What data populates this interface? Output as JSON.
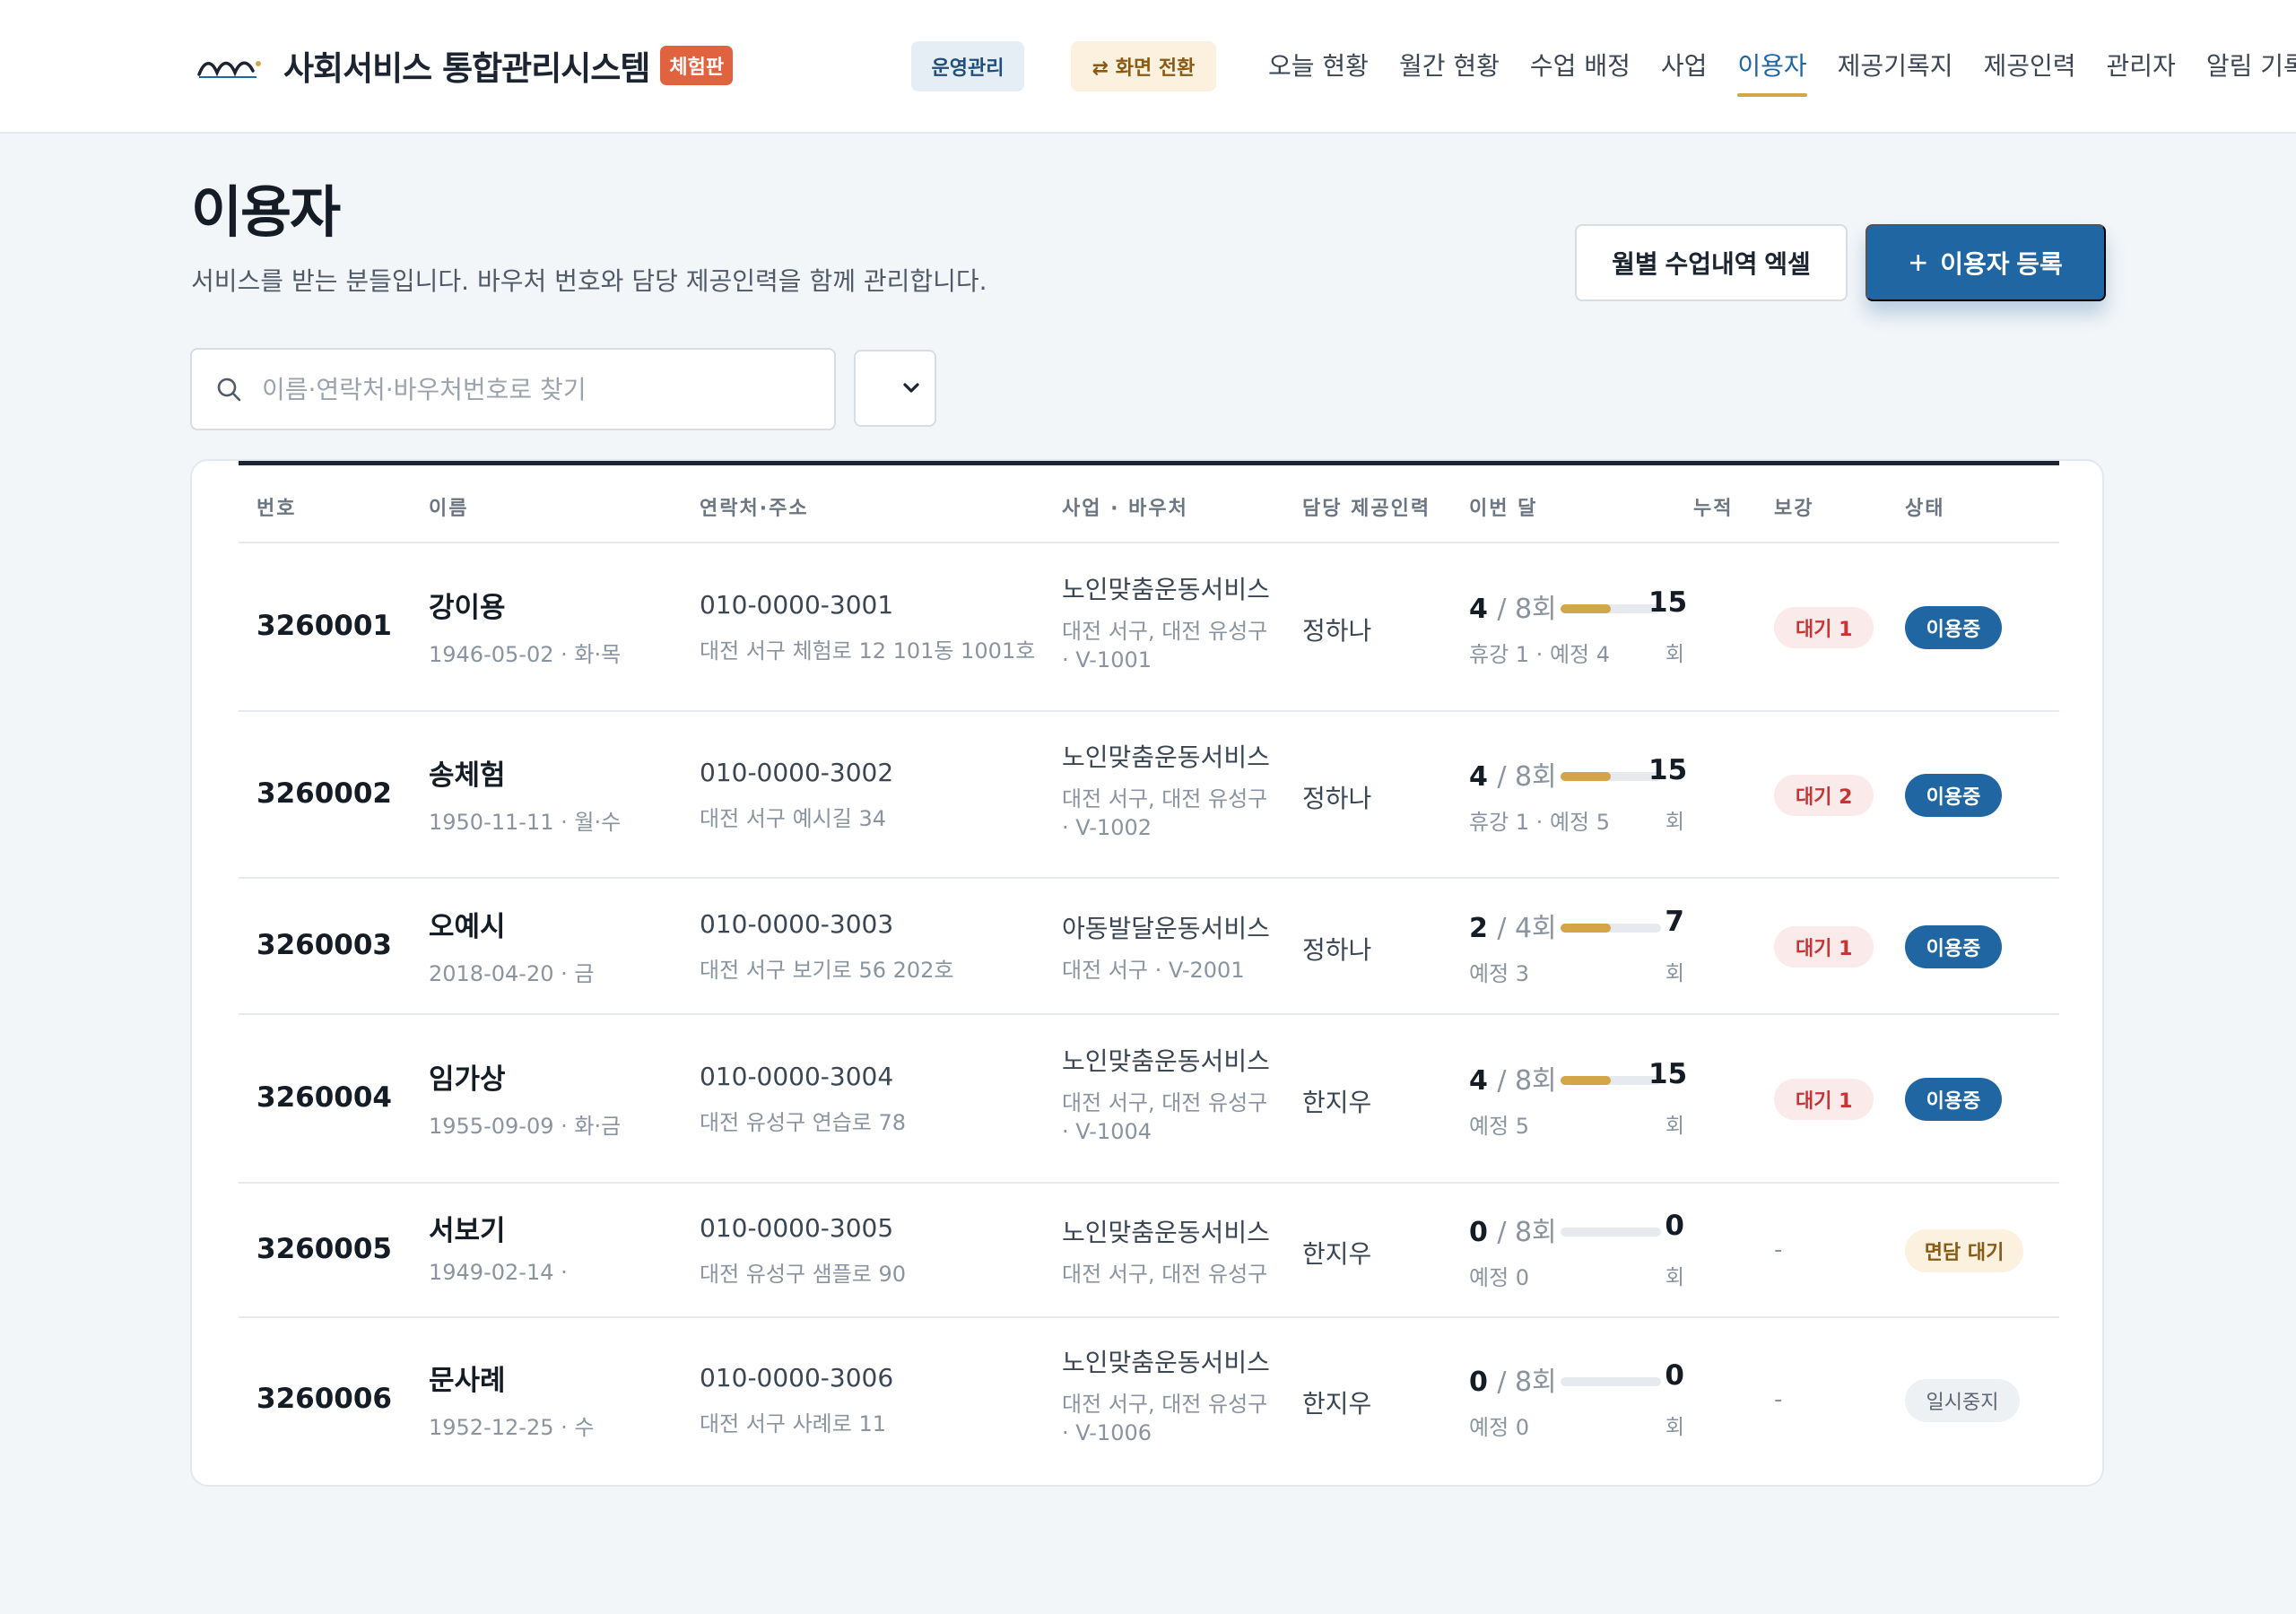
{
  "header": {
    "brand_title": "사회서비스 통합관리시스템",
    "brand_badge": "체험판",
    "ops_chip": "운영관리",
    "switch_chip": "⇄ 화면 전환",
    "nav": [
      "오늘 현황",
      "월간 현황",
      "수업 배정",
      "사업",
      "이용자",
      "제공기록지",
      "제공인력",
      "관리자",
      "알림 기록"
    ],
    "active_nav": "이용자"
  },
  "page": {
    "title": "이용자",
    "subtitle": "서비스를 받는 분들입니다. 바우처 번호와 담당 제공인력을 함께 관리합니다.",
    "excel_button": "월별 수업내역 엑셀",
    "add_button": "이용자 등록",
    "add_icon": "+"
  },
  "search": {
    "placeholder": "이름·연락처·바우처번호로 찾기",
    "value": ""
  },
  "filter": {
    "selected": ""
  },
  "table": {
    "columns": [
      "번호",
      "이름",
      "연락처·주소",
      "사업 · 바우처",
      "담당 제공인력",
      "이번 달",
      "누적",
      "보강",
      "상태"
    ],
    "rows": [
      {
        "id": "3260001",
        "name": "강이용",
        "meta": "1946-05-02 · 화·목",
        "phone": "010-0000-3001",
        "address": "대전 서구 체험로 12 101동 1001호",
        "program": "노인맞춤운동서비스",
        "region": "대전 서구, 대전 유성구",
        "voucher": "· V-1001",
        "staff": "정하나",
        "done": "4",
        "planned": "/ 8회",
        "progress": 0.5,
        "month_note": "휴강 1 · 예정 4",
        "total": "15",
        "total_unit": "회",
        "makeup": "대기 1",
        "status": "이용중",
        "status_type": "active"
      },
      {
        "id": "3260002",
        "name": "송체험",
        "meta": "1950-11-11 · 월·수",
        "phone": "010-0000-3002",
        "address": "대전 서구 예시길 34",
        "program": "노인맞춤운동서비스",
        "region": "대전 서구, 대전 유성구",
        "voucher": "· V-1002",
        "staff": "정하나",
        "done": "4",
        "planned": "/ 8회",
        "progress": 0.5,
        "month_note": "휴강 1 · 예정 5",
        "total": "15",
        "total_unit": "회",
        "makeup": "대기 2",
        "status": "이용중",
        "status_type": "active"
      },
      {
        "id": "3260003",
        "name": "오예시",
        "meta": "2018-04-20 · 금",
        "phone": "010-0000-3003",
        "address": "대전 서구 보기로 56 202호",
        "program": "아동발달운동서비스",
        "region": "대전 서구 · V-2001",
        "voucher": "",
        "staff": "정하나",
        "done": "2",
        "planned": "/ 4회",
        "progress": 0.5,
        "month_note": "예정 3",
        "total": "7",
        "total_unit": "회",
        "makeup": "대기 1",
        "status": "이용중",
        "status_type": "active"
      },
      {
        "id": "3260004",
        "name": "임가상",
        "meta": "1955-09-09 · 화·금",
        "phone": "010-0000-3004",
        "address": "대전 유성구 연습로 78",
        "program": "노인맞춤운동서비스",
        "region": "대전 서구, 대전 유성구",
        "voucher": "· V-1004",
        "staff": "한지우",
        "done": "4",
        "planned": "/ 8회",
        "progress": 0.5,
        "month_note": "예정 5",
        "total": "15",
        "total_unit": "회",
        "makeup": "대기 1",
        "status": "이용중",
        "status_type": "active"
      },
      {
        "id": "3260005",
        "name": "서보기",
        "meta": "1949-02-14 ·",
        "phone": "010-0000-3005",
        "address": "대전 유성구 샘플로 90",
        "program": "노인맞춤운동서비스",
        "region": "대전 서구, 대전 유성구",
        "voucher": "",
        "staff": "한지우",
        "done": "0",
        "planned": "/ 8회",
        "progress": 0,
        "month_note": "예정 0",
        "total": "0",
        "total_unit": "회",
        "makeup": "-",
        "status": "면담 대기",
        "status_type": "pending"
      },
      {
        "id": "3260006",
        "name": "문사례",
        "meta": "1952-12-25 · 수",
        "phone": "010-0000-3006",
        "address": "대전 서구 사례로 11",
        "program": "노인맞춤운동서비스",
        "region": "대전 서구, 대전 유성구",
        "voucher": "· V-1006",
        "staff": "한지우",
        "done": "0",
        "planned": "/ 8회",
        "progress": 0,
        "month_note": "예정 0",
        "total": "0",
        "total_unit": "회",
        "makeup": "-",
        "status": "일시중지",
        "status_type": "paused"
      }
    ]
  },
  "colors": {
    "primary": "#1f66a3",
    "accent": "#d4a548",
    "brand_badge": "#e0623f",
    "danger": "#c43636"
  }
}
